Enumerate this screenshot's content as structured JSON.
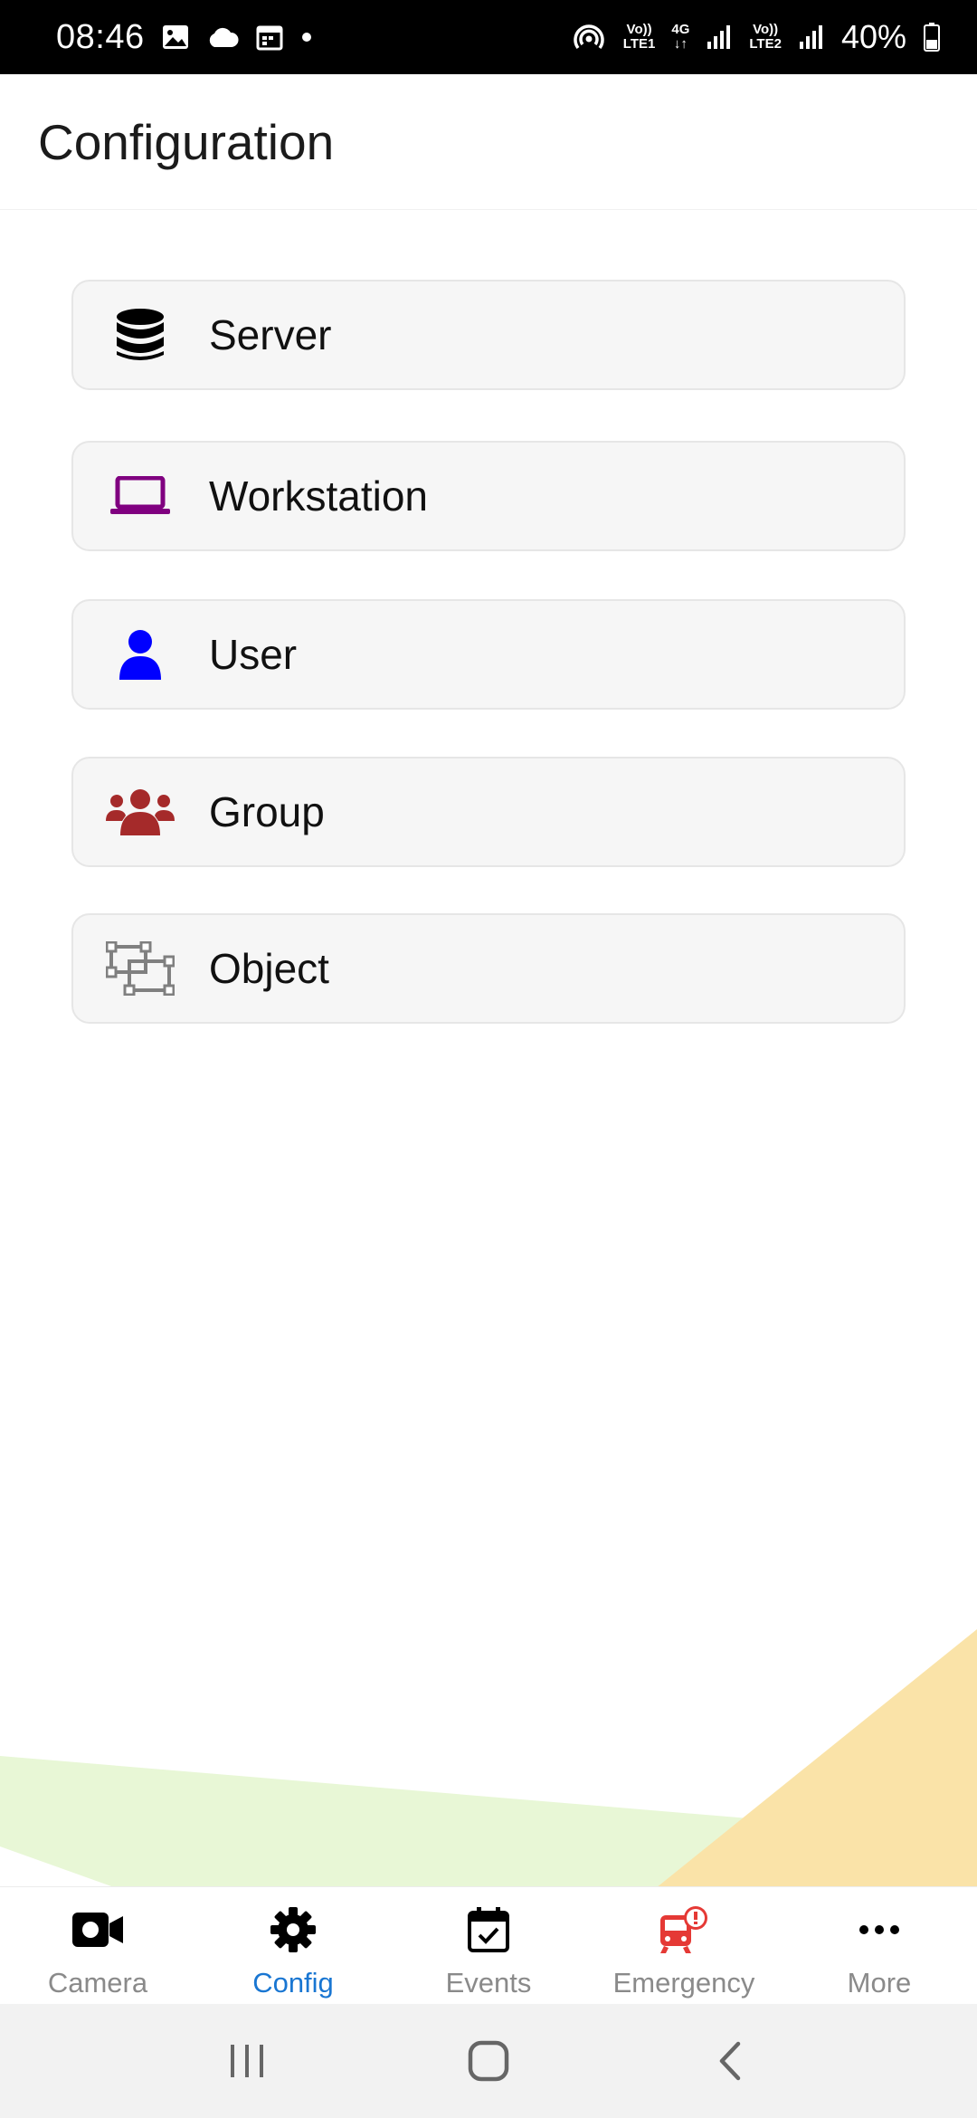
{
  "status_bar": {
    "time": "08:46",
    "network1_top": "Vo))",
    "network1_bottom": "LTE1",
    "network_type": "4G",
    "network2_top": "Vo))",
    "network2_bottom": "LTE2",
    "battery": "40%"
  },
  "header": {
    "title": "Configuration"
  },
  "menu": {
    "items": [
      {
        "label": "Server",
        "icon": "database-icon",
        "color": "#000000"
      },
      {
        "label": "Workstation",
        "icon": "laptop-icon",
        "color": "#800080"
      },
      {
        "label": "User",
        "icon": "user-icon",
        "color": "#0000ff"
      },
      {
        "label": "Group",
        "icon": "users-icon",
        "color": "#a52a2a"
      },
      {
        "label": "Object",
        "icon": "object-group-icon",
        "color": "#808080"
      }
    ]
  },
  "bottom_nav": {
    "items": [
      {
        "label": "Camera",
        "icon": "video-camera-icon",
        "active": false
      },
      {
        "label": "Config",
        "icon": "gear-icon",
        "active": true
      },
      {
        "label": "Events",
        "icon": "calendar-check-icon",
        "active": false
      },
      {
        "label": "Emergency",
        "icon": "train-alert-icon",
        "active": false
      },
      {
        "label": "More",
        "icon": "ellipsis-icon",
        "active": false
      }
    ],
    "active_color": "#1976d2",
    "inactive_color": "#8a8a8a",
    "emergency_color": "#e53935"
  },
  "system_nav": {
    "buttons": [
      "recent-apps-icon",
      "home-icon",
      "back-icon"
    ]
  }
}
